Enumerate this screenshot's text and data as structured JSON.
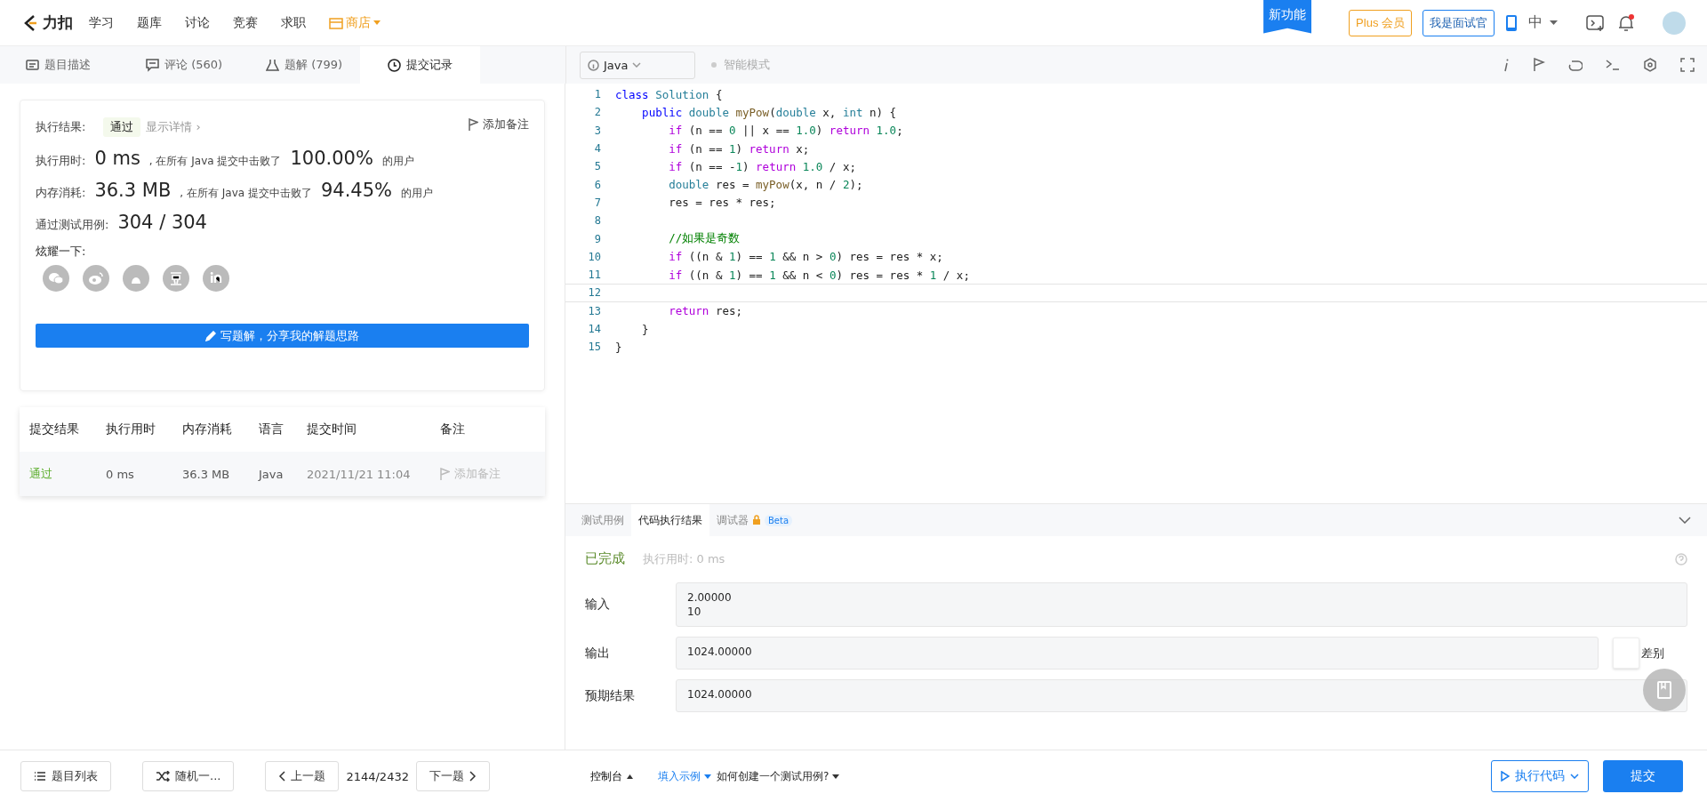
{
  "nav": {
    "logo_text": "力扣",
    "items": [
      {
        "label": "学习",
        "kind": "plain"
      },
      {
        "label": "题库",
        "kind": "plain"
      },
      {
        "label": "讨论",
        "kind": "plain"
      },
      {
        "label": "竞赛",
        "kind": "plain"
      },
      {
        "label": "求职",
        "kind": "plain"
      },
      {
        "label": "商店",
        "kind": "store"
      }
    ],
    "new_feature": "新功能",
    "plus": "Plus 会员",
    "interviewer": "我是面试官",
    "language": "中"
  },
  "tabs": [
    {
      "label": "题目描述",
      "selected": false
    },
    {
      "label": "评论 (560)",
      "selected": false
    },
    {
      "label": "题解 (799)",
      "selected": false
    },
    {
      "label": "提交记录",
      "selected": true
    }
  ],
  "editor_toolbar": {
    "language": "Java",
    "mode": "智能模式"
  },
  "result": {
    "status_label": "执行结果:",
    "status": "通过",
    "details": "显示详情 ›",
    "add_note": "添加备注",
    "stats": [
      {
        "label": "执行用时:",
        "value": "0 ms",
        "middle": ", 在所有 Java 提交中击败了",
        "percent": "100.00%",
        "suffix": "的用户"
      },
      {
        "label": "内存消耗:",
        "value": "36.3 MB",
        "middle": ", 在所有 Java 提交中击败了",
        "percent": "94.45%",
        "suffix": "的用户"
      }
    ],
    "cases_label": "通过测试用例:",
    "cases": "304 / 304",
    "share_label": "炫耀一下:",
    "write_button": "写题解，分享我的解题思路"
  },
  "submissions": {
    "columns": [
      "提交结果",
      "执行用时",
      "内存消耗",
      "语言",
      "提交时间",
      "备注"
    ],
    "rows": [
      {
        "result": "通过",
        "time": "0 ms",
        "memory": "36.3 MB",
        "language": "Java",
        "submitted": "2021/11/21 11:04",
        "note": "添加备注"
      }
    ]
  },
  "code": [
    {
      "number": "1",
      "current": false,
      "tokens": [
        {
          "kind": "kw2",
          "t": "class "
        },
        {
          "kind": "type",
          "t": "Solution"
        },
        {
          "kind": "plain",
          "t": " {"
        }
      ]
    },
    {
      "number": "2",
      "current": false,
      "tokens": [
        {
          "kind": "kw2",
          "t": "    public "
        },
        {
          "kind": "type",
          "t": "double "
        },
        {
          "kind": "fn",
          "t": "myPow"
        },
        {
          "kind": "plain",
          "t": "("
        },
        {
          "kind": "type",
          "t": "double "
        },
        {
          "kind": "plain",
          "t": "x, "
        },
        {
          "kind": "type",
          "t": "int "
        },
        {
          "kind": "plain",
          "t": "n) {"
        }
      ]
    },
    {
      "number": "3",
      "current": false,
      "tokens": [
        {
          "kind": "kw",
          "t": "        if "
        },
        {
          "kind": "plain",
          "t": "(n == "
        },
        {
          "kind": "num",
          "t": "0"
        },
        {
          "kind": "plain",
          "t": " || x == "
        },
        {
          "kind": "num",
          "t": "1.0"
        },
        {
          "kind": "plain",
          "t": ") "
        },
        {
          "kind": "kw",
          "t": "return "
        },
        {
          "kind": "num",
          "t": "1.0"
        },
        {
          "kind": "plain",
          "t": ";"
        }
      ]
    },
    {
      "number": "4",
      "current": false,
      "tokens": [
        {
          "kind": "kw",
          "t": "        if "
        },
        {
          "kind": "plain",
          "t": "(n == "
        },
        {
          "kind": "num",
          "t": "1"
        },
        {
          "kind": "plain",
          "t": ") "
        },
        {
          "kind": "kw",
          "t": "return "
        },
        {
          "kind": "plain",
          "t": "x;"
        }
      ]
    },
    {
      "number": "5",
      "current": false,
      "tokens": [
        {
          "kind": "kw",
          "t": "        if "
        },
        {
          "kind": "plain",
          "t": "(n == -"
        },
        {
          "kind": "num",
          "t": "1"
        },
        {
          "kind": "plain",
          "t": ") "
        },
        {
          "kind": "kw",
          "t": "return "
        },
        {
          "kind": "num",
          "t": "1.0"
        },
        {
          "kind": "plain",
          "t": " / x;"
        }
      ]
    },
    {
      "number": "6",
      "current": false,
      "tokens": [
        {
          "kind": "type",
          "t": "        double "
        },
        {
          "kind": "plain",
          "t": "res = "
        },
        {
          "kind": "fn",
          "t": "myPow"
        },
        {
          "kind": "plain",
          "t": "(x, n / "
        },
        {
          "kind": "num",
          "t": "2"
        },
        {
          "kind": "plain",
          "t": ");"
        }
      ]
    },
    {
      "number": "7",
      "current": false,
      "tokens": [
        {
          "kind": "plain",
          "t": "        res = res * res;"
        }
      ]
    },
    {
      "number": "8",
      "current": false
    },
    {
      "number": "9",
      "current": false,
      "tokens": [
        {
          "kind": "comment",
          "t": "        //如果是奇数"
        }
      ]
    },
    {
      "number": "10",
      "current": false,
      "tokens": [
        {
          "kind": "kw",
          "t": "        if "
        },
        {
          "kind": "plain",
          "t": "((n & "
        },
        {
          "kind": "num",
          "t": "1"
        },
        {
          "kind": "plain",
          "t": ") == "
        },
        {
          "kind": "num",
          "t": "1"
        },
        {
          "kind": "plain",
          "t": " && n > "
        },
        {
          "kind": "num",
          "t": "0"
        },
        {
          "kind": "plain",
          "t": ") res = res * x;"
        }
      ]
    },
    {
      "number": "11",
      "current": false,
      "tokens": [
        {
          "kind": "kw",
          "t": "        if "
        },
        {
          "kind": "plain",
          "t": "((n & "
        },
        {
          "kind": "num",
          "t": "1"
        },
        {
          "kind": "plain",
          "t": ") == "
        },
        {
          "kind": "num",
          "t": "1"
        },
        {
          "kind": "plain",
          "t": " && n < "
        },
        {
          "kind": "num",
          "t": "0"
        },
        {
          "kind": "plain",
          "t": ") res = res * "
        },
        {
          "kind": "num",
          "t": "1"
        },
        {
          "kind": "plain",
          "t": " / x;"
        }
      ]
    },
    {
      "number": "12",
      "current": true
    },
    {
      "number": "13",
      "current": false,
      "tokens": [
        {
          "kind": "kw",
          "t": "        return "
        },
        {
          "kind": "plain",
          "t": "res;"
        }
      ]
    },
    {
      "number": "14",
      "current": false,
      "tokens": [
        {
          "kind": "plain",
          "t": "    }"
        }
      ]
    },
    {
      "number": "15",
      "current": false,
      "tokens": [
        {
          "kind": "plain",
          "t": "}"
        }
      ]
    }
  ],
  "console": {
    "tabs": [
      {
        "label": "测试用例",
        "selected": false
      },
      {
        "label": "代码执行结果",
        "selected": true
      },
      {
        "label": "调试器",
        "selected": false,
        "badge": "Beta"
      }
    ],
    "status": "已完成",
    "runtime": "执行用时: 0 ms",
    "fields": [
      {
        "label": "输入",
        "lines": [
          "2.00000",
          "10"
        ]
      },
      {
        "label": "输出",
        "lines": [
          "1024.00000"
        ],
        "diff": {
          "label": "差别",
          "on": false
        }
      },
      {
        "label": "预期结果",
        "lines": [
          "1024.00000"
        ]
      }
    ]
  },
  "footer": {
    "problem_list": "题目列表",
    "random": "随机一...",
    "prev": "上一题",
    "counter": "2144/2432",
    "next": "下一题",
    "console": "控制台",
    "fill_example": "填入示例",
    "how_to": "如何创建一个测试用例?",
    "run": "执行代码",
    "submit": "提交"
  }
}
